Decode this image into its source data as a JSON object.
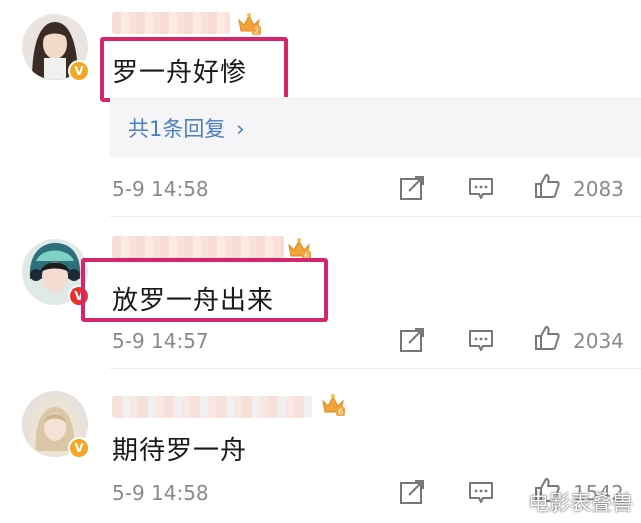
{
  "comments": [
    {
      "text": "罗一舟好惨",
      "reply_link": "共1条回复",
      "reply_chevron": "›",
      "time": "5-9 14:58",
      "likes": "2083",
      "badge": "V",
      "crown_level": "2"
    },
    {
      "text": "放罗一舟出来",
      "time": "5-9 14:57",
      "likes": "2034",
      "badge": "V",
      "crown_level": "6"
    },
    {
      "text": "期待罗一舟",
      "time": "5-9 14:58",
      "likes": "1542",
      "badge": "V",
      "crown_level": "6"
    }
  ],
  "icons": {
    "repost": "share-edit-icon",
    "comment": "comment-bubble-icon",
    "like": "thumbs-up-icon"
  },
  "watermark": "电影表叠兽",
  "colors": {
    "highlight": "#d6266b",
    "link": "#4a7fc1",
    "meta": "#8a8a8a",
    "badge_gold": "#f5a623",
    "badge_red": "#e8332a"
  }
}
